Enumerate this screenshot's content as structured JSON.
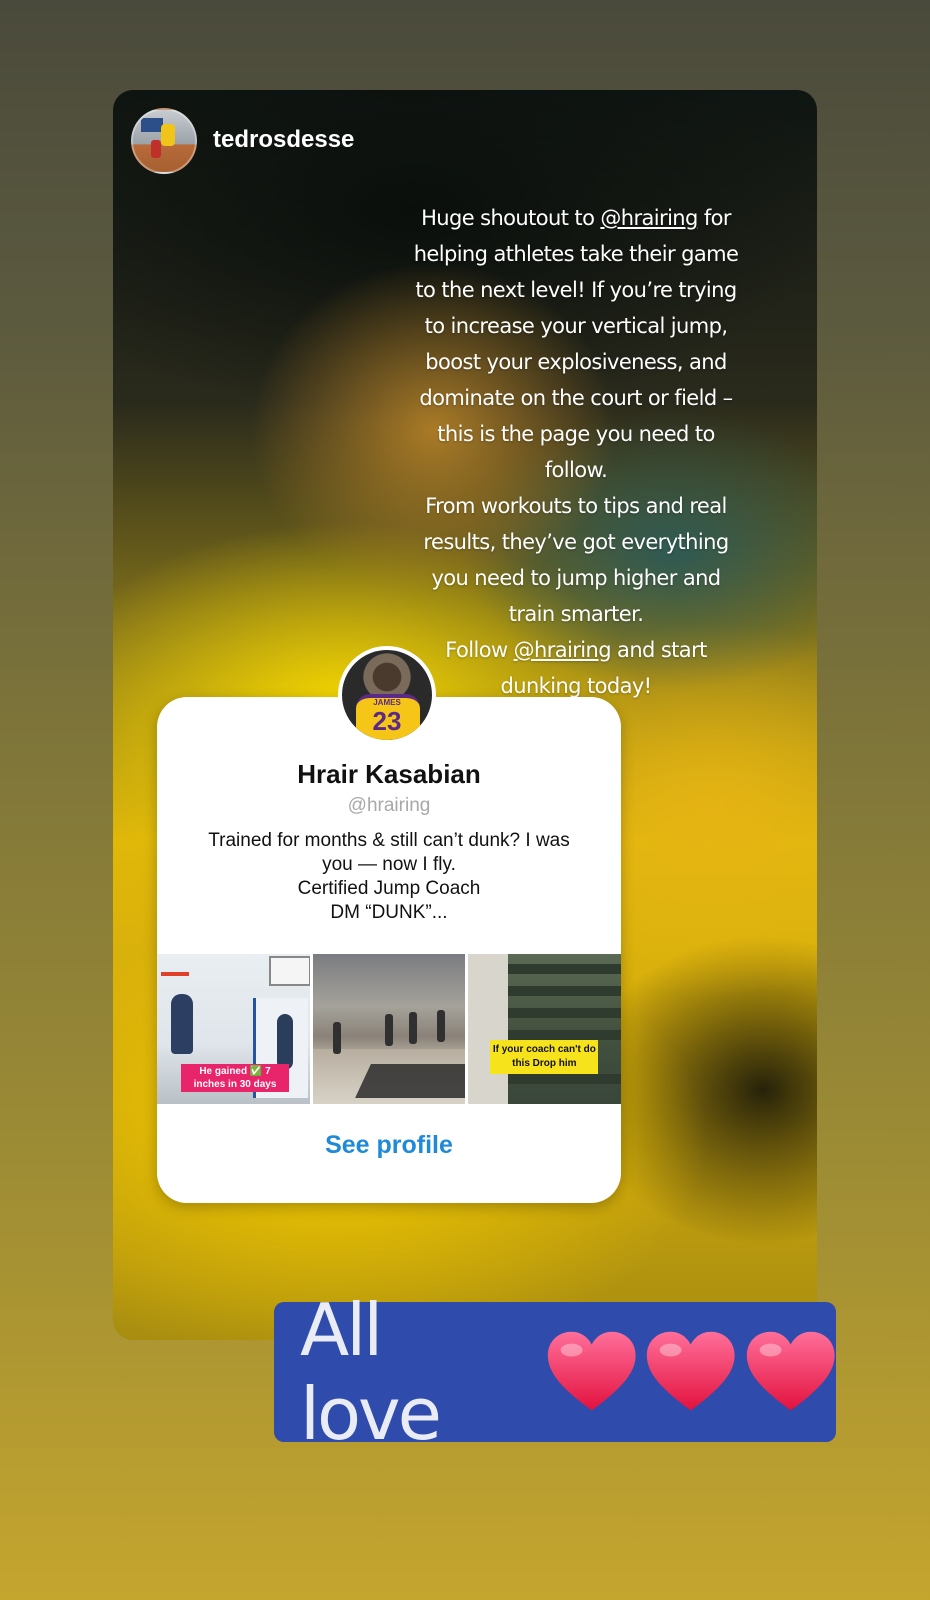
{
  "story": {
    "author": {
      "username": "tedrosdesse",
      "avatar_icon": "profile-photo-basketball"
    },
    "caption": {
      "p1_before": "Huge shoutout to ",
      "p1_mention": "@hrairing",
      "p1_after": " for helping athletes take their game to the next level! If you’re trying to increase your vertical jump, boost your explosiveness, and dominate on the court or field – this is the page you need to follow.",
      "p2": "From workouts to tips and real results, they’ve got everything you need to jump higher and train smarter.",
      "p3_before": "Follow ",
      "p3_mention": "@hrairing",
      "p3_after": " and start dunking today!"
    },
    "profile_card": {
      "avatar_icon": "profile-photo-jersey-23",
      "jersey_name": "JAMES",
      "jersey_number": "23",
      "name": "Hrair Kasabian",
      "handle": "@hrairing",
      "bio": "Trained for months & still can’t dunk? I was\nyou — now I fly.\nCertified Jump Coach\nDM “DUNK”...",
      "thumbnails": [
        {
          "overlay_text": "He gained ✅ 7 inches in 30 days",
          "overlay_color": "#e8246a"
        },
        {
          "overlay_text": ""
        },
        {
          "overlay_text": "If your coach can't do this Drop him",
          "overlay_color": "#f7e31c"
        }
      ],
      "cta_label": "See profile",
      "cta_color": "#1f8ad8"
    },
    "sticker": {
      "text": "All love",
      "hearts": 3,
      "background": "#2f4bab",
      "heart_icon": "red-heart-emoji"
    }
  }
}
